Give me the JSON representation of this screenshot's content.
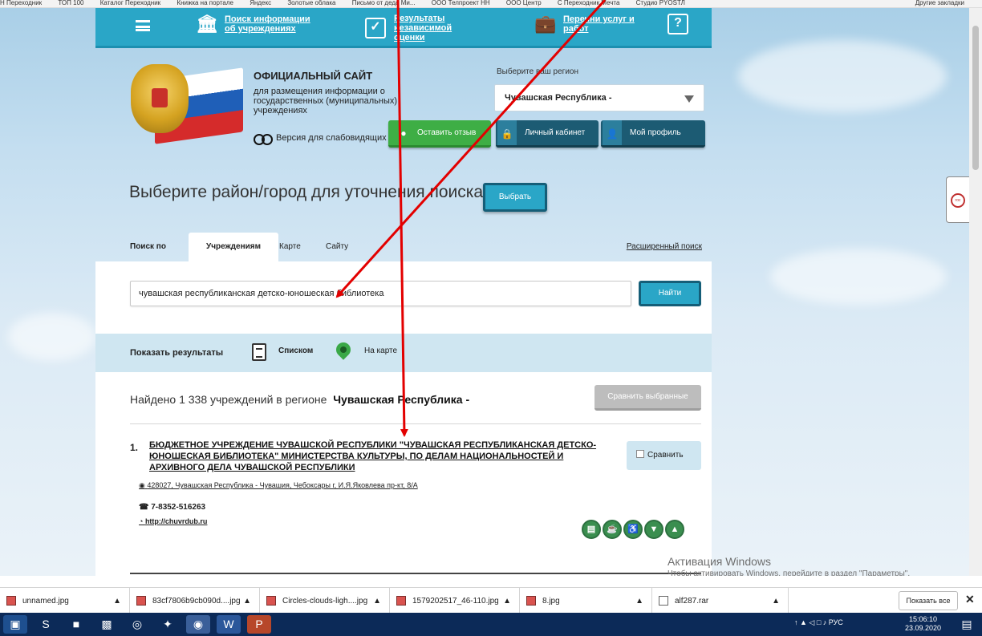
{
  "bookmarks": {
    "items": [
      "Н Переходник",
      "ТОП 100",
      "Каталог Переходник",
      "Книжка на портале",
      "Яндекс",
      "Золотые облака",
      "Письмо от деда Ми...",
      "ООО Телпроект НН",
      "ООО Центр",
      "С Переходник Мечта",
      "Студио PYOSТЛ"
    ],
    "other": "Другие закладки"
  },
  "nav": {
    "items": [
      {
        "label": "Поиск информации об учреждениях",
        "icon": "institution-icon"
      },
      {
        "label": "Результаты независимой оценки",
        "icon": "checkmark-icon"
      },
      {
        "label": "Перечни услуг и работ",
        "icon": "briefcase-icon"
      }
    ],
    "help_icon": "question-icon"
  },
  "header": {
    "title": "ОФИЦИАЛЬНЫЙ САЙТ",
    "subtitle": "для размещения информации о государственных (муниципальных) учреждениях",
    "low_vision": "Версия для слабовидящих",
    "region_label": "Выберите ваш регион",
    "region_value": "Чувашская Республика -",
    "feedback": "Оставить отзыв",
    "cabinet": "Личный кабинет",
    "profile": "Мой профиль"
  },
  "district": {
    "text": "Выберите район/город для уточнения поиска",
    "button": "Выбрать"
  },
  "search": {
    "search_by": "Поиск по",
    "tabs": [
      "Учреждениям",
      "Карте",
      "Сайту"
    ],
    "advanced": "Расширенный поиск",
    "query": "чувашская республиканская детско-юношеская библиотека",
    "find": "Найти"
  },
  "show": {
    "label": "Показать результаты",
    "list": "Списком",
    "map": "На карте"
  },
  "results": {
    "found_prefix": "Найдено 1 338 учреждений  в регионе",
    "found_region": "Чувашская Республика -",
    "compare_selected": "Сравнить выбранные",
    "items": [
      {
        "num": "1.",
        "name": "БЮДЖЕТНОЕ УЧРЕЖДЕНИЕ ЧУВАШСКОЙ РЕСПУБЛИКИ \"ЧУВАШСКАЯ РЕСПУБЛИКАНСКАЯ ДЕТСКО-ЮНОШЕСКАЯ БИБЛИОТЕКА\" МИНИСТЕРСТВА КУЛЬТУРЫ, ПО ДЕЛАМ НАЦИОНАЛЬНОСТЕЙ И АРХИВНОГО ДЕЛА ЧУВАШСКОЙ РЕСПУБЛИКИ",
        "address": "428027, Чувашская Республика - Чувашия, Чебоксары г, И.Я.Яковлева пр-кт, 8/А",
        "phone": "7-8352-516263",
        "website": "http://chuvrdub.ru",
        "compare": "Сравнить"
      }
    ]
  },
  "activation": {
    "title": "Активация Windows",
    "text": "Чтобы активировать Windows, перейдите в раздел \"Параметры\"."
  },
  "downloads": {
    "files": [
      "unnamed.jpg",
      "83cf7806b9cb090d....jpg",
      "Circles-clouds-ligh....jpg",
      "1579202517_46-110.jpg",
      "8.jpg",
      "alf287.rar"
    ],
    "show_all": "Показать все"
  },
  "taskbar": {
    "lang": "РУС",
    "time": "15:06:10",
    "date": "23.09.2020"
  },
  "colors": {
    "nav": "#2aa6c7",
    "dark_button": "#1c5b73",
    "green_button": "#3eae45",
    "arrow": "#e30000"
  }
}
